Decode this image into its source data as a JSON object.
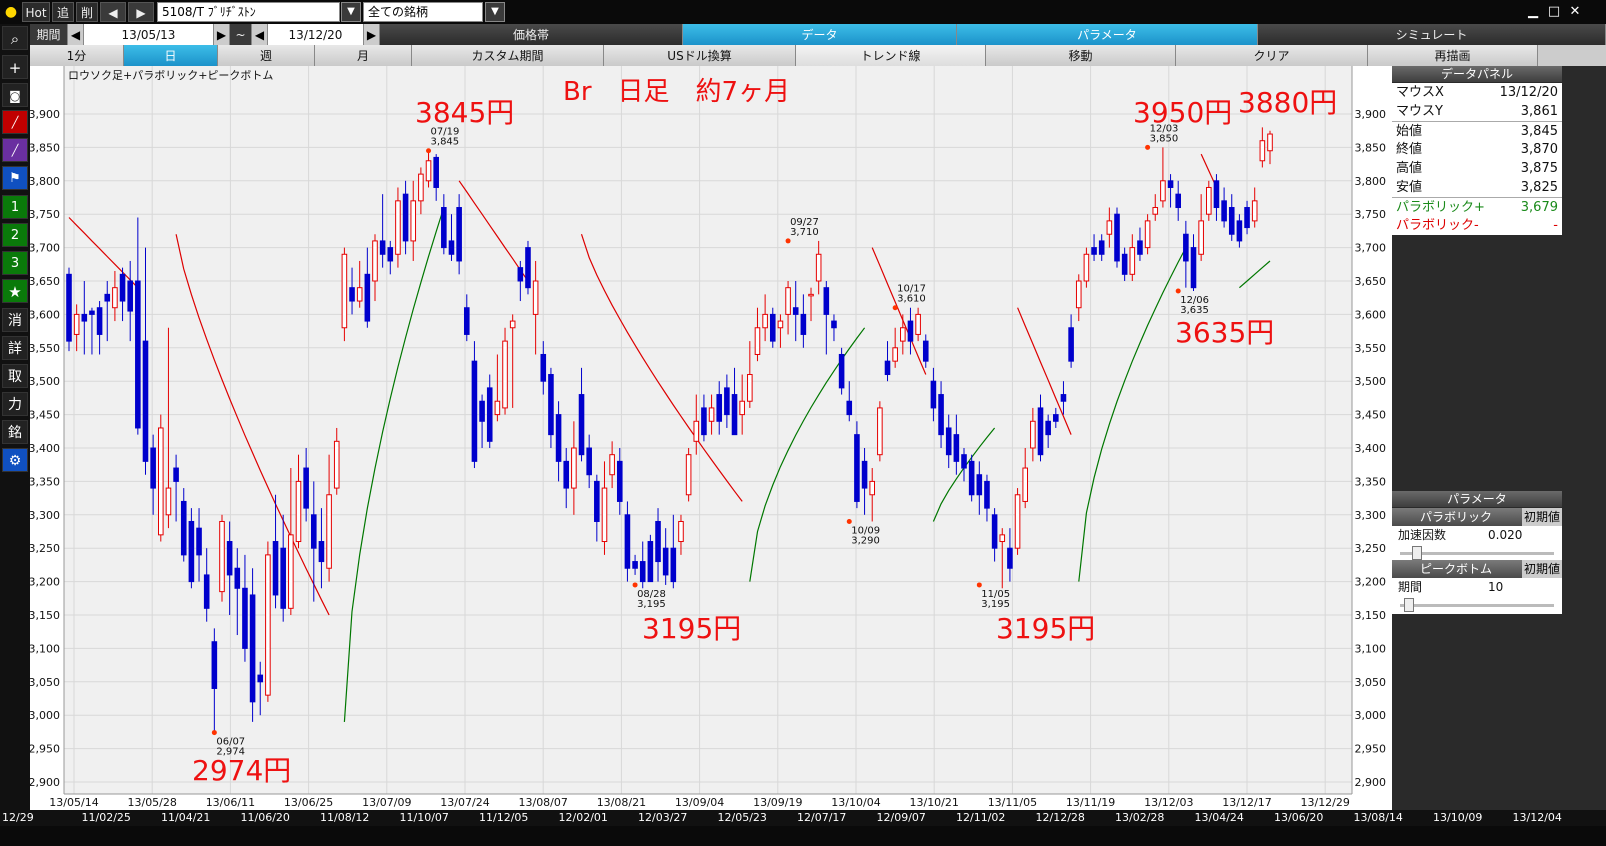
{
  "topbar": {
    "hot": "Hot",
    "add": "追",
    "del": "削",
    "prev": "◀",
    "next": "▶",
    "symbol": "5108/T ﾌﾞﾘﾁﾞｽﾄﾝ",
    "filter": "全ての銘柄"
  },
  "row2": {
    "period_label": "期間",
    "start_date": "13/05/13",
    "tilde": "~",
    "end_date": "13/12/20",
    "tabs": [
      "価格帯",
      "データ",
      "パラメータ",
      "シミュレート"
    ]
  },
  "row3": {
    "buttons": [
      "1分",
      "日",
      "週",
      "月",
      "カスタム期間",
      "USドル換算",
      "トレンド線",
      "移動",
      "クリア",
      "再描画"
    ]
  },
  "left_toolbar": [
    "＋",
    "⊙",
    "",
    "",
    "",
    "1",
    "2",
    "3",
    "★",
    "消",
    "詳",
    "取",
    "力",
    "銘",
    "⚙"
  ],
  "chart": {
    "indicator_label": "ロウソク足+パラボリック+ピークボトム",
    "title_annotation": "Br　日足　約7ヶ月",
    "ytick_labels": [
      "3,900",
      "3,850",
      "3,800",
      "3,750",
      "3,700",
      "3,650",
      "3,600",
      "3,550",
      "3,500",
      "3,450",
      "3,400",
      "3,350",
      "3,300",
      "3,250",
      "3,200",
      "3,150",
      "3,100",
      "3,050",
      "3,000",
      "2,950",
      "2,900"
    ],
    "xtick_labels": [
      "13/05/14",
      "13/05/28",
      "13/06/11",
      "13/06/25",
      "13/07/09",
      "13/07/24",
      "13/08/07",
      "13/08/21",
      "13/09/04",
      "13/09/19",
      "13/10/04",
      "13/10/21",
      "13/11/05",
      "13/11/19",
      "13/12/03",
      "13/12/17",
      "13/12/29"
    ],
    "peak_labels": [
      {
        "date": "06/07",
        "value": "2,974"
      },
      {
        "date": "07/19",
        "value": "3,845"
      },
      {
        "date": "08/28",
        "value": "3,195"
      },
      {
        "date": "09/27",
        "value": "3,710"
      },
      {
        "date": "10/09",
        "value": "3,290"
      },
      {
        "date": "10/17",
        "value": "3,610"
      },
      {
        "date": "11/05",
        "value": "3,195"
      },
      {
        "date": "12/03",
        "value": "3,850"
      },
      {
        "date": "12/06",
        "value": "3,635"
      }
    ],
    "red_annotations": [
      "3845円",
      "2974円",
      "3195円",
      "3195円",
      "3950円",
      "3880円",
      "3635円"
    ],
    "colors": {
      "up": "#e60000",
      "down": "#0000cc",
      "sar_plus": "#007700",
      "sar_minus": "#dd0000",
      "bg": "#f0f0f0",
      "annotation": "#ee1111"
    }
  },
  "chart_data": {
    "type": "candlestick",
    "title": "Br　日足　約7ヶ月",
    "ylim": [
      2880,
      3930
    ],
    "x_ticks": [
      "13/05/14",
      "13/05/28",
      "13/06/11",
      "13/06/25",
      "13/07/09",
      "13/07/24",
      "13/08/07",
      "13/08/21",
      "13/09/04",
      "13/09/19",
      "13/10/04",
      "13/10/21",
      "13/11/05",
      "13/11/19",
      "13/12/03",
      "13/12/17"
    ],
    "candles": [
      [
        3660,
        3560,
        3670,
        3545
      ],
      [
        3570,
        3600,
        3615,
        3545
      ],
      [
        3600,
        3590,
        3650,
        3540
      ],
      [
        3605,
        3600,
        3610,
        3540
      ],
      [
        3610,
        3570,
        3620,
        3540
      ],
      [
        3630,
        3620,
        3650,
        3560
      ],
      [
        3610,
        3640,
        3665,
        3590
      ],
      [
        3660,
        3620,
        3670,
        3590
      ],
      [
        3650,
        3605,
        3680,
        3560
      ],
      [
        3650,
        3430,
        3745,
        3420
      ],
      [
        3560,
        3380,
        3700,
        3360
      ],
      [
        3400,
        3340,
        3420,
        3300
      ],
      [
        3270,
        3430,
        3450,
        3260
      ],
      [
        3300,
        3340,
        3580,
        3280
      ],
      [
        3370,
        3350,
        3390,
        3290
      ],
      [
        3320,
        3240,
        3340,
        3230
      ],
      [
        3290,
        3200,
        3310,
        3190
      ],
      [
        3280,
        3240,
        3310,
        3200
      ],
      [
        3210,
        3160,
        3250,
        3140
      ],
      [
        3110,
        3040,
        3130,
        2975
      ],
      [
        3185,
        3290,
        3300,
        3170
      ],
      [
        3260,
        3210,
        3290,
        3150
      ],
      [
        3220,
        3190,
        3250,
        3120
      ],
      [
        3190,
        3100,
        3240,
        3080
      ],
      [
        3180,
        3020,
        3220,
        2990
      ],
      [
        3060,
        3050,
        3080,
        3000
      ],
      [
        3030,
        3240,
        3260,
        3020
      ],
      [
        3260,
        3180,
        3330,
        3160
      ],
      [
        3250,
        3160,
        3300,
        3140
      ],
      [
        3160,
        3270,
        3370,
        3150
      ],
      [
        3260,
        3350,
        3390,
        3250
      ],
      [
        3370,
        3310,
        3400,
        3290
      ],
      [
        3300,
        3250,
        3350,
        3170
      ],
      [
        3260,
        3230,
        3310,
        3190
      ],
      [
        3220,
        3330,
        3390,
        3200
      ],
      [
        3340,
        3410,
        3430,
        3330
      ],
      [
        3580,
        3690,
        3700,
        3560
      ],
      [
        3640,
        3620,
        3670,
        3600
      ],
      [
        3620,
        3640,
        3680,
        3610
      ],
      [
        3660,
        3590,
        3700,
        3580
      ],
      [
        3650,
        3710,
        3720,
        3620
      ],
      [
        3710,
        3690,
        3780,
        3670
      ],
      [
        3700,
        3680,
        3710,
        3660
      ],
      [
        3690,
        3770,
        3790,
        3670
      ],
      [
        3780,
        3710,
        3800,
        3690
      ],
      [
        3710,
        3770,
        3800,
        3680
      ],
      [
        3770,
        3810,
        3820,
        3750
      ],
      [
        3800,
        3830,
        3845,
        3790
      ],
      [
        3835,
        3790,
        3840,
        3770
      ],
      [
        3760,
        3700,
        3780,
        3690
      ],
      [
        3710,
        3690,
        3750,
        3680
      ],
      [
        3760,
        3680,
        3780,
        3660
      ],
      [
        3610,
        3570,
        3630,
        3560
      ],
      [
        3530,
        3380,
        3560,
        3370
      ],
      [
        3470,
        3440,
        3480,
        3400
      ],
      [
        3490,
        3410,
        3510,
        3400
      ],
      [
        3450,
        3470,
        3540,
        3440
      ],
      [
        3460,
        3560,
        3580,
        3450
      ],
      [
        3580,
        3590,
        3600,
        3460
      ],
      [
        3670,
        3650,
        3680,
        3620
      ],
      [
        3700,
        3640,
        3710,
        3630
      ],
      [
        3600,
        3650,
        3680,
        3540
      ],
      [
        3540,
        3500,
        3560,
        3480
      ],
      [
        3510,
        3420,
        3520,
        3400
      ],
      [
        3450,
        3380,
        3470,
        3350
      ],
      [
        3380,
        3340,
        3400,
        3310
      ],
      [
        3340,
        3400,
        3440,
        3300
      ],
      [
        3480,
        3390,
        3520,
        3380
      ],
      [
        3400,
        3360,
        3420,
        3340
      ],
      [
        3350,
        3290,
        3360,
        3260
      ],
      [
        3260,
        3340,
        3380,
        3240
      ],
      [
        3360,
        3390,
        3410,
        3340
      ],
      [
        3380,
        3320,
        3400,
        3300
      ],
      [
        3300,
        3220,
        3320,
        3200
      ],
      [
        3230,
        3220,
        3240,
        3210
      ],
      [
        3230,
        3200,
        3260,
        3190
      ],
      [
        3260,
        3200,
        3270,
        3200
      ],
      [
        3290,
        3230,
        3310,
        3200
      ],
      [
        3250,
        3210,
        3280,
        3195
      ],
      [
        3250,
        3200,
        3300,
        3190
      ],
      [
        3260,
        3290,
        3300,
        3240
      ],
      [
        3330,
        3390,
        3400,
        3320
      ],
      [
        3410,
        3440,
        3480,
        3390
      ],
      [
        3460,
        3420,
        3480,
        3410
      ],
      [
        3440,
        3460,
        3480,
        3420
      ],
      [
        3480,
        3440,
        3500,
        3420
      ],
      [
        3490,
        3450,
        3510,
        3430
      ],
      [
        3480,
        3420,
        3520,
        3420
      ],
      [
        3450,
        3470,
        3510,
        3420
      ],
      [
        3470,
        3510,
        3560,
        3460
      ],
      [
        3540,
        3580,
        3610,
        3530
      ],
      [
        3580,
        3600,
        3630,
        3560
      ],
      [
        3600,
        3560,
        3610,
        3550
      ],
      [
        3580,
        3590,
        3600,
        3550
      ],
      [
        3600,
        3640,
        3650,
        3570
      ],
      [
        3610,
        3600,
        3650,
        3560
      ],
      [
        3600,
        3570,
        3630,
        3550
      ],
      [
        3630,
        3630,
        3640,
        3590
      ],
      [
        3650,
        3690,
        3710,
        3630
      ],
      [
        3640,
        3600,
        3650,
        3540
      ],
      [
        3590,
        3580,
        3600,
        3560
      ],
      [
        3540,
        3490,
        3550,
        3480
      ],
      [
        3470,
        3450,
        3500,
        3440
      ],
      [
        3420,
        3320,
        3440,
        3310
      ],
      [
        3380,
        3340,
        3400,
        3300
      ],
      [
        3330,
        3350,
        3370,
        3290
      ],
      [
        3390,
        3460,
        3470,
        3380
      ],
      [
        3530,
        3510,
        3560,
        3500
      ],
      [
        3530,
        3550,
        3580,
        3520
      ],
      [
        3560,
        3580,
        3600,
        3540
      ],
      [
        3590,
        3560,
        3610,
        3540
      ],
      [
        3570,
        3600,
        3610,
        3560
      ],
      [
        3560,
        3530,
        3570,
        3520
      ],
      [
        3500,
        3460,
        3520,
        3440
      ],
      [
        3480,
        3420,
        3500,
        3400
      ],
      [
        3430,
        3390,
        3450,
        3370
      ],
      [
        3420,
        3380,
        3450,
        3360
      ],
      [
        3390,
        3370,
        3400,
        3350
      ],
      [
        3380,
        3330,
        3390,
        3320
      ],
      [
        3360,
        3330,
        3380,
        3300
      ],
      [
        3350,
        3310,
        3360,
        3290
      ],
      [
        3300,
        3250,
        3310,
        3230
      ],
      [
        3260,
        3270,
        3280,
        3190
      ],
      [
        3250,
        3220,
        3280,
        3200
      ],
      [
        3250,
        3330,
        3340,
        3240
      ],
      [
        3320,
        3370,
        3400,
        3310
      ],
      [
        3400,
        3440,
        3460,
        3380
      ],
      [
        3460,
        3390,
        3480,
        3380
      ],
      [
        3440,
        3420,
        3450,
        3400
      ],
      [
        3450,
        3440,
        3460,
        3430
      ],
      [
        3480,
        3470,
        3500,
        3450
      ],
      [
        3580,
        3530,
        3600,
        3520
      ],
      [
        3610,
        3650,
        3660,
        3590
      ],
      [
        3650,
        3690,
        3700,
        3640
      ],
      [
        3700,
        3690,
        3720,
        3680
      ],
      [
        3710,
        3690,
        3720,
        3680
      ],
      [
        3720,
        3740,
        3760,
        3700
      ],
      [
        3750,
        3680,
        3760,
        3670
      ],
      [
        3690,
        3660,
        3700,
        3650
      ],
      [
        3660,
        3700,
        3720,
        3650
      ],
      [
        3710,
        3690,
        3730,
        3680
      ],
      [
        3700,
        3740,
        3750,
        3690
      ],
      [
        3750,
        3760,
        3780,
        3740
      ],
      [
        3770,
        3800,
        3850,
        3760
      ],
      [
        3800,
        3790,
        3810,
        3760
      ],
      [
        3780,
        3760,
        3800,
        3740
      ],
      [
        3720,
        3680,
        3740,
        3640
      ],
      [
        3700,
        3640,
        3720,
        3635
      ],
      [
        3690,
        3740,
        3780,
        3680
      ],
      [
        3750,
        3790,
        3800,
        3740
      ],
      [
        3800,
        3760,
        3810,
        3740
      ],
      [
        3770,
        3740,
        3790,
        3730
      ],
      [
        3760,
        3720,
        3780,
        3710
      ],
      [
        3740,
        3710,
        3750,
        3700
      ],
      [
        3760,
        3730,
        3770,
        3720
      ],
      [
        3740,
        3770,
        3790,
        3730
      ],
      [
        3830,
        3860,
        3880,
        3820
      ],
      [
        3845,
        3870,
        3875,
        3825
      ]
    ],
    "peaks": [
      {
        "date": "06/07",
        "value": 2974,
        "type": "bottom"
      },
      {
        "date": "07/19",
        "value": 3845,
        "type": "peak"
      },
      {
        "date": "08/28",
        "value": 3195,
        "type": "bottom"
      },
      {
        "date": "09/27",
        "value": 3710,
        "type": "peak"
      },
      {
        "date": "10/09",
        "value": 3290,
        "type": "bottom"
      },
      {
        "date": "10/17",
        "value": 3610,
        "type": "peak"
      },
      {
        "date": "11/05",
        "value": 3195,
        "type": "bottom"
      },
      {
        "date": "12/03",
        "value": 3850,
        "type": "peak"
      },
      {
        "date": "12/06",
        "value": 3635,
        "type": "bottom"
      }
    ]
  },
  "data_panel": {
    "title": "データパネル",
    "rows": [
      {
        "k": "マウスX",
        "v": "13/12/20"
      },
      {
        "k": "マウスY",
        "v": "3,861"
      },
      {
        "k": "始値",
        "v": "3,845"
      },
      {
        "k": "終値",
        "v": "3,870"
      },
      {
        "k": "高値",
        "v": "3,875"
      },
      {
        "k": "安値",
        "v": "3,825"
      }
    ],
    "para_plus_label": "パラボリック+",
    "para_plus_value": "3,679",
    "para_minus_label": "パラボリック-",
    "para_minus_value": "-"
  },
  "param_panel": {
    "title": "パラメータ",
    "parabolic_label": "パラボリック",
    "reset1": "初期値",
    "accel_label": "加速因数",
    "accel_value": "0.020",
    "accel_slider": 0.1,
    "peak_label": "ピークボトム",
    "reset2": "初期値",
    "period_label": "期間",
    "period_value": "10",
    "period_slider": 0.05
  },
  "bottom_dates": [
    "12/29",
    "11/02/25",
    "11/04/21",
    "11/06/20",
    "11/08/12",
    "11/10/07",
    "11/12/05",
    "12/02/01",
    "12/03/27",
    "12/05/23",
    "12/07/17",
    "12/09/07",
    "12/11/02",
    "12/12/28",
    "13/02/28",
    "13/04/24",
    "13/06/20",
    "13/08/14",
    "13/10/09",
    "13/12/04"
  ]
}
